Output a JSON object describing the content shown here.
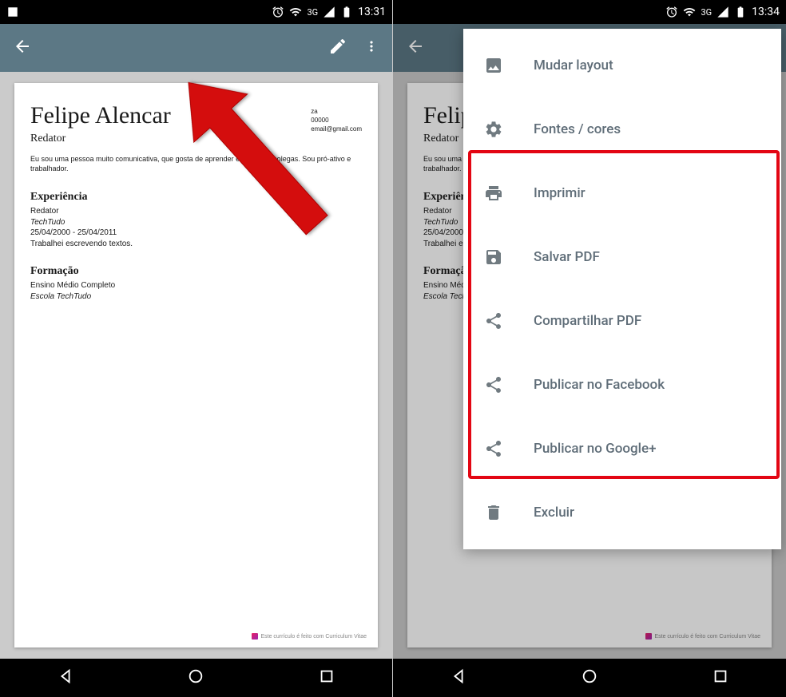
{
  "status": {
    "time_left": "13:31",
    "time_right": "13:34",
    "network": "3G"
  },
  "resume": {
    "name": "Felipe Alencar",
    "role": "Redator",
    "summary": "Eu sou uma pessoa muito comunicativa, que gosta de aprender e ajudar os colegas. Sou pró-ativo e trabalhador.",
    "contact": {
      "city": "za",
      "phone": "00000",
      "email": "email@gmail.com"
    },
    "experience": {
      "title": "Experiência",
      "role": "Redator",
      "company": "TechTudo",
      "dates": "25/04/2000 - 25/04/2011",
      "desc": "Trabalhei escrevendo textos."
    },
    "education": {
      "title": "Formação",
      "level": "Ensino Médio Completo",
      "school": "Escola TechTudo"
    },
    "footer": "Este currículo é feito com Curriculum Vitae"
  },
  "menu": {
    "items": [
      {
        "icon": "image",
        "label": "Mudar layout"
      },
      {
        "icon": "gear",
        "label": "Fontes / cores"
      },
      {
        "icon": "print",
        "label": "Imprimir"
      },
      {
        "icon": "save",
        "label": "Salvar PDF"
      },
      {
        "icon": "share",
        "label": "Compartilhar PDF"
      },
      {
        "icon": "share",
        "label": "Publicar no Facebook"
      },
      {
        "icon": "share",
        "label": "Publicar no Google+"
      },
      {
        "icon": "trash",
        "label": "Excluir"
      }
    ]
  }
}
